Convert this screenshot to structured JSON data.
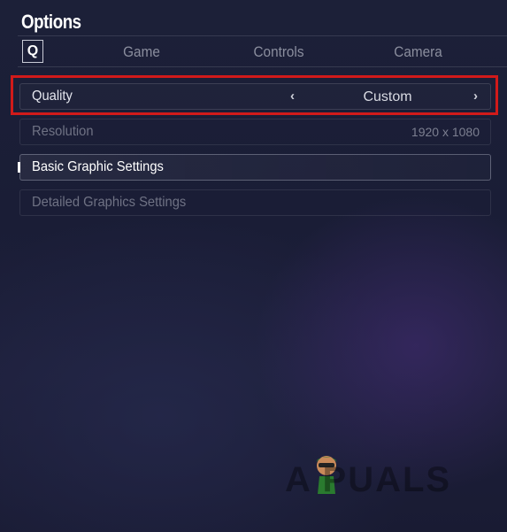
{
  "header": {
    "title": "Options"
  },
  "tabs": {
    "key_hint": "Q",
    "items": [
      {
        "label": "Game"
      },
      {
        "label": "Controls"
      },
      {
        "label": "Camera"
      }
    ]
  },
  "settings": {
    "quality": {
      "label": "Quality",
      "value": "Custom"
    },
    "resolution": {
      "label": "Resolution",
      "value": "1920 x 1080"
    },
    "basic": {
      "label": "Basic Graphic Settings"
    },
    "detailed": {
      "label": "Detailed Graphics Settings"
    }
  },
  "colors": {
    "highlight": "#d11a1a",
    "background": "#1c2038"
  },
  "watermark": {
    "text": "A PUALS"
  }
}
